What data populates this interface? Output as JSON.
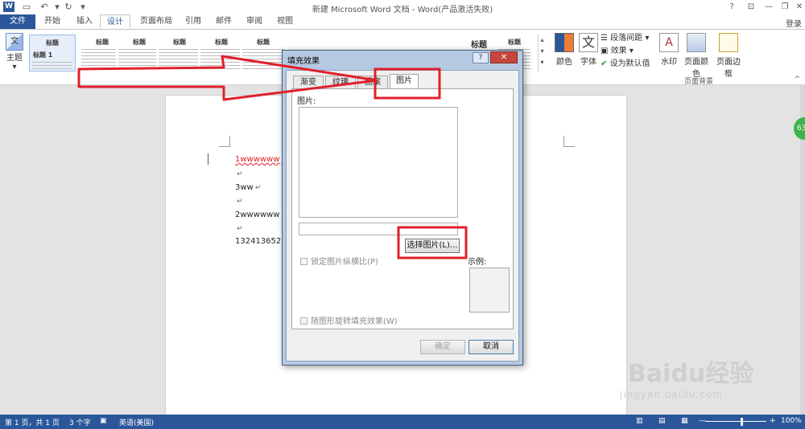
{
  "window": {
    "title": "新建 Microsoft Word 文档 - Word(产品激活失败)",
    "help_label": "?",
    "restore_label": "⊡",
    "minimize_label": "—",
    "maximize_label": "❐",
    "close_label": "✕"
  },
  "quick_access": {
    "save_icon": "save-icon",
    "undo_icon": "undo-icon",
    "redo_icon": "redo-icon"
  },
  "tabs": [
    "文件",
    "开始",
    "插入",
    "设计",
    "页面布局",
    "引用",
    "邮件",
    "审阅",
    "视图"
  ],
  "active_tab": "设计",
  "login_label": "登录",
  "ribbon": {
    "theme_label": "主题",
    "style_heading": "标题",
    "style_first_title": "标题",
    "style_first_heading": "标题 1",
    "colors_label": "颜色",
    "fonts_label": "字体",
    "paragraph_spacing_label": "段落间距",
    "effects_label": "效果",
    "set_default_label": "设为默认值",
    "watermark_label": "水印",
    "page_color_label": "页面颜色",
    "page_border_label": "页面边框",
    "page_background_group": "页面背景"
  },
  "document": {
    "lines": [
      "1wwwwww",
      "",
      "3ww",
      "",
      "2wwwwww",
      "",
      "132413652"
    ],
    "paragraph_mark": "↵"
  },
  "badge_label": "63",
  "dialog": {
    "title": "填充效果",
    "tabs": [
      "渐变",
      "纹理",
      "图案",
      "图片"
    ],
    "active_tab": "图片",
    "picture_label": "图片:",
    "select_picture_label": "选择图片(L)...",
    "lock_aspect_label": "锁定图片纵横比(P)",
    "rotate_with_shape_label": "随图形旋转填充效果(W)",
    "sample_label": "示例:",
    "ok_label": "确定",
    "cancel_label": "取消"
  },
  "statusbar": {
    "page_info": "第 1 页，共 1 页",
    "word_count": "3 个字",
    "language": "英语(美国)",
    "zoom_percent": "100%",
    "zoom_minus": "—",
    "zoom_plus": "+"
  },
  "watermark": {
    "logo": "Baidu经验",
    "url": "jingyan.baidu.com"
  },
  "colors": {
    "accent": "#2b579a",
    "highlight_red": "#e0202a"
  }
}
